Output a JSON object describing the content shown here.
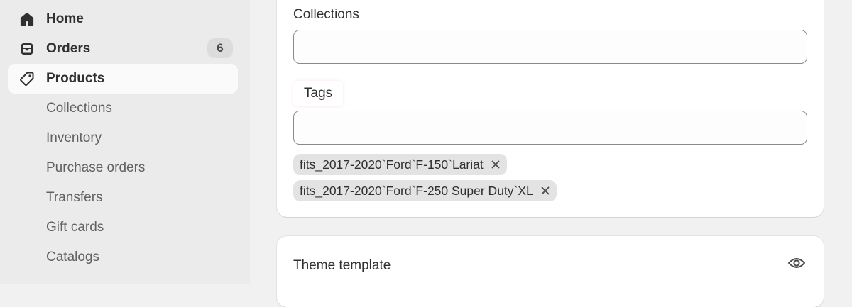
{
  "sidebar": {
    "items": [
      {
        "label": "Home",
        "icon": "home-icon"
      },
      {
        "label": "Orders",
        "icon": "inbox-icon",
        "badge": "6"
      },
      {
        "label": "Products",
        "icon": "tag-icon",
        "active": true
      },
      {
        "label": "Collections"
      },
      {
        "label": "Inventory"
      },
      {
        "label": "Purchase orders"
      },
      {
        "label": "Transfers"
      },
      {
        "label": "Gift cards"
      },
      {
        "label": "Catalogs"
      }
    ]
  },
  "organization": {
    "collections_label": "Collections",
    "collections_value": "",
    "tags_label": "Tags",
    "tags_value": "",
    "tags": [
      "fits_2017-2020`Ford`F-150`Lariat",
      "fits_2017-2020`Ford`F-250 Super Duty`XL"
    ]
  },
  "theme": {
    "title": "Theme template",
    "icon": "eye-icon"
  },
  "colors": {
    "page_bg": "#f1f1f1",
    "sidebar_bg": "#ebebeb",
    "active_item_bg": "#fafafa",
    "tag_bg": "#e3e3e3",
    "badge_bg": "#dcdcdc"
  }
}
